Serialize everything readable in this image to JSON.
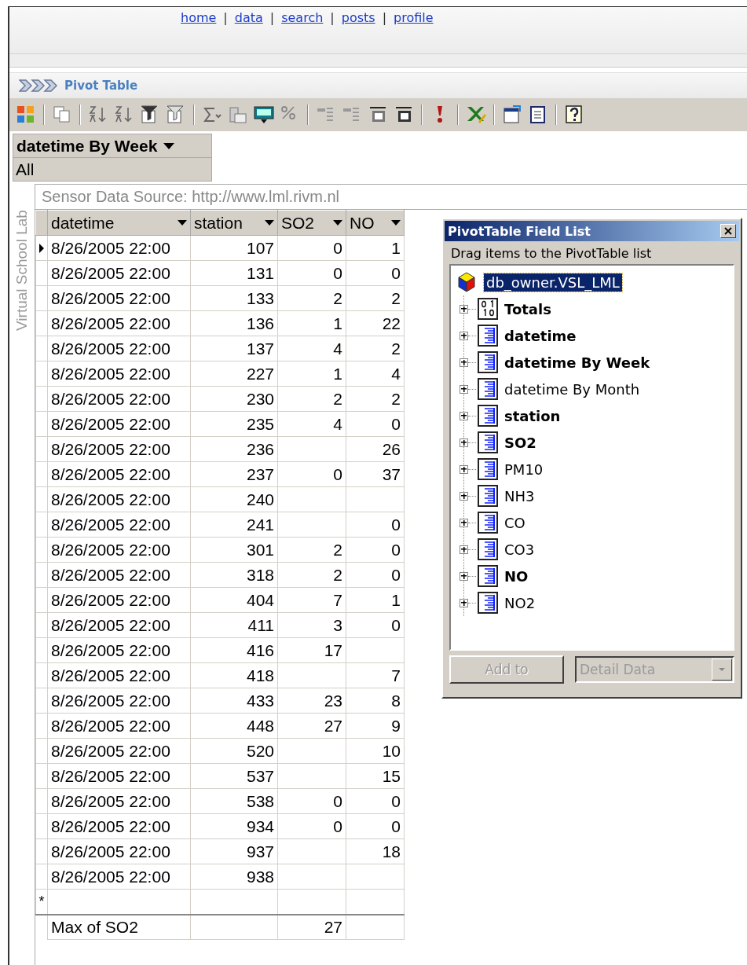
{
  "nav": [
    {
      "kind": "link",
      "text": "home"
    },
    {
      "kind": "separator",
      "text": "|"
    },
    {
      "kind": "link",
      "text": "data"
    },
    {
      "kind": "separator",
      "text": "|"
    },
    {
      "kind": "link",
      "text": "search"
    },
    {
      "kind": "separator",
      "text": "|"
    },
    {
      "kind": "link",
      "text": "posts"
    },
    {
      "kind": "separator",
      "text": "|"
    },
    {
      "kind": "link",
      "text": "profile"
    }
  ],
  "panel_title": "Pivot Table",
  "filter": {
    "field": "datetime By Week",
    "value": "All"
  },
  "source_caption": "Sensor Data Source: http://www.lml.rivm.nl",
  "side_label": "Virtual School Lab",
  "table": {
    "columns": [
      "datetime",
      "station",
      "SO2",
      "NO"
    ],
    "rows": [
      {
        "selected": true,
        "cells": [
          "8/26/2005 22:00",
          "107",
          "0",
          "1"
        ]
      },
      {
        "selected": false,
        "cells": [
          "8/26/2005 22:00",
          "131",
          "0",
          "0"
        ]
      },
      {
        "selected": false,
        "cells": [
          "8/26/2005 22:00",
          "133",
          "2",
          "2"
        ]
      },
      {
        "selected": false,
        "cells": [
          "8/26/2005 22:00",
          "136",
          "1",
          "22"
        ]
      },
      {
        "selected": false,
        "cells": [
          "8/26/2005 22:00",
          "137",
          "4",
          "2"
        ]
      },
      {
        "selected": false,
        "cells": [
          "8/26/2005 22:00",
          "227",
          "1",
          "4"
        ]
      },
      {
        "selected": false,
        "cells": [
          "8/26/2005 22:00",
          "230",
          "2",
          "2"
        ]
      },
      {
        "selected": false,
        "cells": [
          "8/26/2005 22:00",
          "235",
          "4",
          "0"
        ]
      },
      {
        "selected": false,
        "cells": [
          "8/26/2005 22:00",
          "236",
          null,
          "26"
        ]
      },
      {
        "selected": false,
        "cells": [
          "8/26/2005 22:00",
          "237",
          "0",
          "37"
        ]
      },
      {
        "selected": false,
        "cells": [
          "8/26/2005 22:00",
          "240",
          null,
          null
        ]
      },
      {
        "selected": false,
        "cells": [
          "8/26/2005 22:00",
          "241",
          null,
          "0"
        ]
      },
      {
        "selected": false,
        "cells": [
          "8/26/2005 22:00",
          "301",
          "2",
          "0"
        ]
      },
      {
        "selected": false,
        "cells": [
          "8/26/2005 22:00",
          "318",
          "2",
          "0"
        ]
      },
      {
        "selected": false,
        "cells": [
          "8/26/2005 22:00",
          "404",
          "7",
          "1"
        ]
      },
      {
        "selected": false,
        "cells": [
          "8/26/2005 22:00",
          "411",
          "3",
          "0"
        ]
      },
      {
        "selected": false,
        "cells": [
          "8/26/2005 22:00",
          "416",
          "17",
          null
        ]
      },
      {
        "selected": false,
        "cells": [
          "8/26/2005 22:00",
          "418",
          null,
          "7"
        ]
      },
      {
        "selected": false,
        "cells": [
          "8/26/2005 22:00",
          "433",
          "23",
          "8"
        ]
      },
      {
        "selected": false,
        "cells": [
          "8/26/2005 22:00",
          "448",
          "27",
          "9"
        ]
      },
      {
        "selected": false,
        "cells": [
          "8/26/2005 22:00",
          "520",
          null,
          "10"
        ]
      },
      {
        "selected": false,
        "cells": [
          "8/26/2005 22:00",
          "537",
          null,
          "15"
        ]
      },
      {
        "selected": false,
        "cells": [
          "8/26/2005 22:00",
          "538",
          "0",
          "0"
        ]
      },
      {
        "selected": false,
        "cells": [
          "8/26/2005 22:00",
          "934",
          "0",
          "0"
        ]
      },
      {
        "selected": false,
        "cells": [
          "8/26/2005 22:00",
          "937",
          null,
          "18"
        ]
      },
      {
        "selected": false,
        "cells": [
          "8/26/2005 22:00",
          "938",
          null,
          null
        ]
      }
    ],
    "new_row_marker": "*",
    "total": {
      "label": "Max of SO2",
      "value": "27"
    }
  },
  "field_list": {
    "title": "PivotTable Field List",
    "hint": "Drag items to the PivotTable list",
    "root": {
      "label": "db_owner.VSL_LML",
      "selected": true
    },
    "fields": [
      {
        "label": "Totals",
        "kind": "totals",
        "used": true
      },
      {
        "label": "datetime",
        "kind": "field",
        "used": true
      },
      {
        "label": "datetime By Week",
        "kind": "field",
        "used": true
      },
      {
        "label": "datetime By Month",
        "kind": "field",
        "used": false
      },
      {
        "label": "station",
        "kind": "field",
        "used": true
      },
      {
        "label": "SO2",
        "kind": "field",
        "used": true
      },
      {
        "label": "PM10",
        "kind": "field",
        "used": false
      },
      {
        "label": "NH3",
        "kind": "field",
        "used": false
      },
      {
        "label": "CO",
        "kind": "field",
        "used": false
      },
      {
        "label": "CO3",
        "kind": "field",
        "used": false
      },
      {
        "label": "NO",
        "kind": "field",
        "used": true
      },
      {
        "label": "NO2",
        "kind": "field",
        "used": false
      }
    ],
    "add_button": {
      "label": "Add to",
      "disabled": true
    },
    "target_dropdown": {
      "value": "Detail Data",
      "disabled": true
    }
  }
}
